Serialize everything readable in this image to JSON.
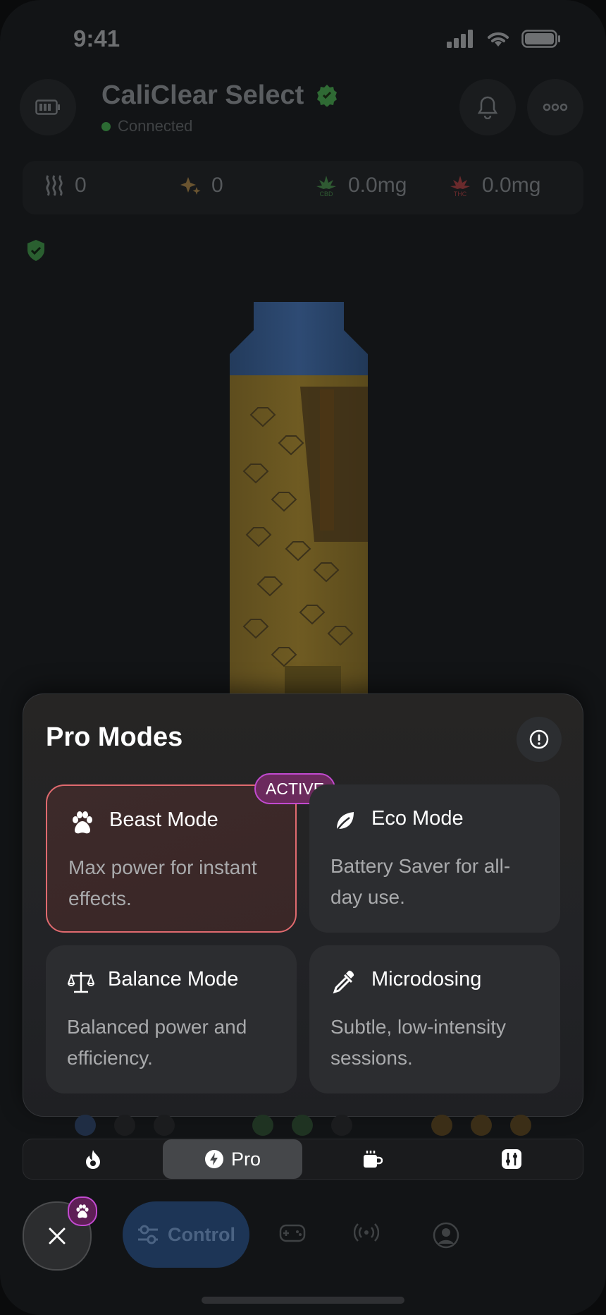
{
  "status": {
    "time": "9:41"
  },
  "header": {
    "title": "CaliClear Select",
    "connection": "Connected"
  },
  "stats": [
    {
      "icon": "steam-icon",
      "value": "0"
    },
    {
      "icon": "sparkle-icon",
      "value": "0"
    },
    {
      "icon": "cbd-leaf-icon",
      "label": "CBD",
      "value": "0.0mg"
    },
    {
      "icon": "thc-leaf-icon",
      "label": "THC",
      "value": "0.0mg"
    }
  ],
  "pro_modes": {
    "title": "Pro Modes",
    "active_badge": "ACTIVE",
    "modes": [
      {
        "icon": "paw-icon",
        "title": "Beast Mode",
        "desc": "Max power for instant effects.",
        "active": true
      },
      {
        "icon": "leaf-icon",
        "title": "Eco Mode",
        "desc": "Battery Saver for all-day use.",
        "active": false
      },
      {
        "icon": "scale-icon",
        "title": "Balance Mode",
        "desc": "Balanced power and efficiency.",
        "active": false
      },
      {
        "icon": "dropper-icon",
        "title": "Microdosing",
        "desc": "Subtle, low-intensity sessions.",
        "active": false
      }
    ]
  },
  "segments": [
    {
      "icon": "flame-icon",
      "label": ""
    },
    {
      "icon": "bolt-icon",
      "label": "Pro",
      "selected": true
    },
    {
      "icon": "cup-icon",
      "label": ""
    },
    {
      "icon": "sliders-icon",
      "label": ""
    }
  ],
  "nav": {
    "control_label": "Control"
  },
  "colors": {
    "accent_active": "#e06a6f",
    "badge_purple": "#c24ad0",
    "connected_green": "#2c6b33"
  }
}
